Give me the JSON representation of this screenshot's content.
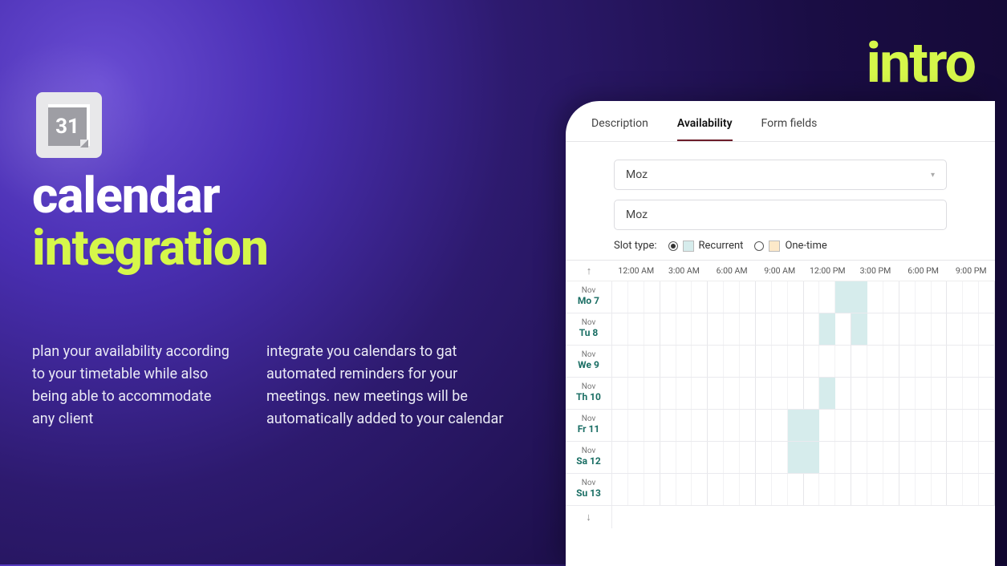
{
  "brand": "intro",
  "icon_day": "31",
  "headline": {
    "line1": "calendar",
    "line2": "integration"
  },
  "copy": {
    "col1": "plan your availability according to your timetable while also being able to accommodate any client",
    "col2": "integrate you calendars to gat automated reminders for your meetings. new meetings will be automatically added to your calendar"
  },
  "panel": {
    "tabs": [
      "Description",
      "Availability",
      "Form fields"
    ],
    "active_tab": 1,
    "select_value": "Moz",
    "input_value": "Moz",
    "slot_type_label": "Slot type:",
    "slot_options": {
      "recurrent": "Recurrent",
      "onetime": "One-time"
    },
    "time_headers": [
      "12:00 AM",
      "3:00 AM",
      "6:00 AM",
      "9:00 AM",
      "12:00 PM",
      "3:00 PM",
      "6:00 PM",
      "9:00 PM"
    ],
    "month": "Nov",
    "days": [
      {
        "label": "Mo 7",
        "slots": [
          [
            14,
            15
          ],
          [
            15,
            16
          ]
        ]
      },
      {
        "label": "Tu 8",
        "slots": [
          [
            13,
            14
          ],
          [
            15,
            16
          ]
        ]
      },
      {
        "label": "We 9",
        "slots": []
      },
      {
        "label": "Th 10",
        "slots": [
          [
            13,
            14
          ]
        ]
      },
      {
        "label": "Fr 11",
        "slots": [
          [
            11,
            13
          ]
        ]
      },
      {
        "label": "Sa 12",
        "slots": [
          [
            11,
            13
          ]
        ]
      },
      {
        "label": "Su 13",
        "slots": []
      }
    ]
  }
}
